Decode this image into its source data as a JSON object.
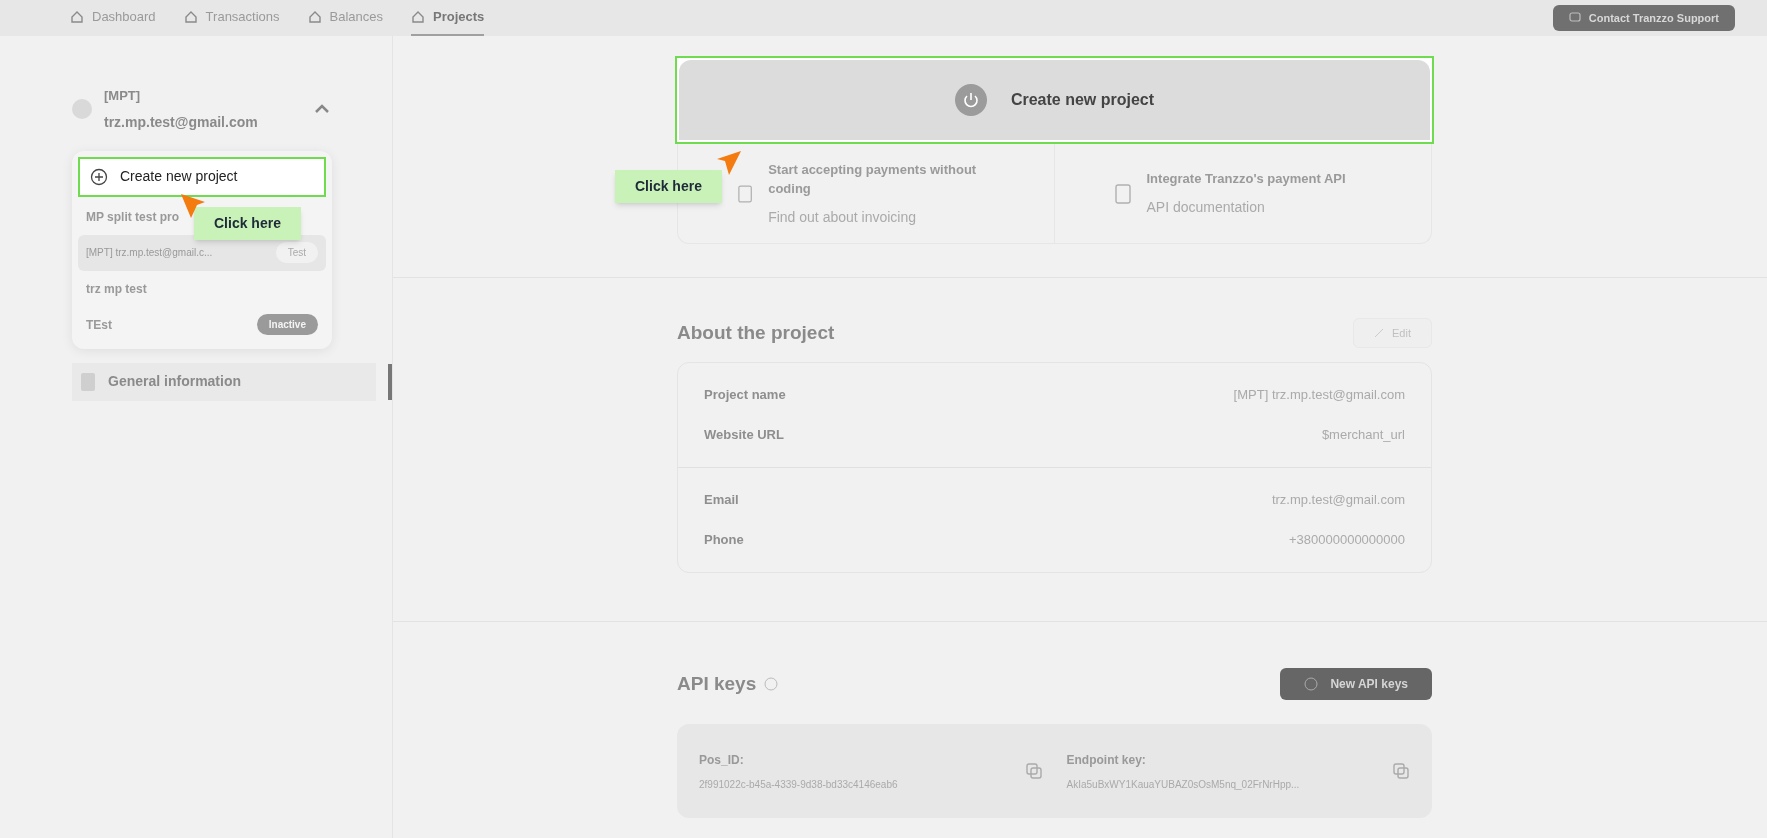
{
  "nav": {
    "tabs": [
      {
        "label": "Dashboard",
        "selected": false
      },
      {
        "label": "Transactions",
        "selected": false
      },
      {
        "label": "Balances",
        "selected": false
      },
      {
        "label": "Projects",
        "selected": true
      }
    ],
    "support_button": "Contact Tranzzo Support"
  },
  "sidebar": {
    "account": {
      "code": "[MPT]",
      "email": "trz.mp.test@gmail.com",
      "expanded": true
    },
    "dropdown": {
      "create_label": "Create new project",
      "projects": [
        {
          "name": "MP split test pro",
          "selected": false
        },
        {
          "name": "[MPT] trz.mp.test@gmail.c...",
          "selected": true,
          "badge": {
            "text": "Test",
            "kind": "test"
          }
        },
        {
          "name": "trz mp test",
          "selected": false
        },
        {
          "name": "TEst",
          "selected": false,
          "badge": {
            "text": "Inactive",
            "kind": "inactive"
          }
        }
      ]
    },
    "menu": [
      {
        "label": "General information",
        "selected": true
      }
    ]
  },
  "main": {
    "create_banner": "Create new project",
    "quick_links": [
      {
        "title": "Start accepting payments without coding",
        "subtitle": "Find out about invoicing"
      },
      {
        "title": "Integrate Tranzzo's payment API",
        "subtitle": "API documentation"
      }
    ],
    "about": {
      "title": "About the project",
      "edit_label": "Edit",
      "groups": [
        [
          {
            "label": "Project name",
            "value": "[MPT] trz.mp.test@gmail.com"
          },
          {
            "label": "Website URL",
            "value": "$merchant_url"
          }
        ],
        [
          {
            "label": "Email",
            "value": "trz.mp.test@gmail.com"
          },
          {
            "label": "Phone",
            "value": "+380000000000000"
          }
        ]
      ]
    },
    "api": {
      "title": "API keys",
      "button": "New API keys",
      "keys": [
        {
          "label": "Pos_ID:",
          "value": "2f991022c-b45a-4339-9d38-bd33c4146eab6"
        },
        {
          "label": "Endpoint key:",
          "value": "AkIa5uBxWY1KauaYUBAZ0sOsM5nq_02FrNrHpp..."
        }
      ]
    }
  },
  "tooltips": [
    {
      "text": "Click here"
    },
    {
      "text": "Click here"
    }
  ]
}
